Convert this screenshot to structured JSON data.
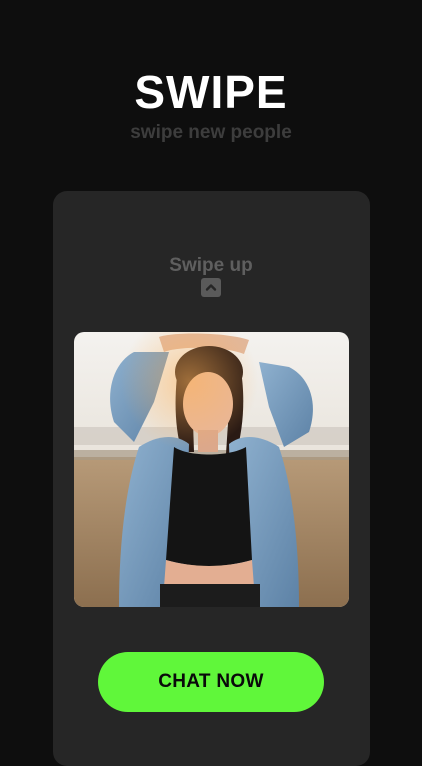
{
  "header": {
    "title": "SWIPE",
    "subtitle": "swipe new people"
  },
  "card": {
    "swipe_label": "Swipe up",
    "swipe_icon": "chevron-up-icon",
    "photo": "profile-photo"
  },
  "cta": {
    "label": "CHAT NOW"
  },
  "colors": {
    "background": "#0e0e0e",
    "card": "#262626",
    "accent": "#60f73a",
    "subtitle": "#3d3d3d",
    "swipe_label": "#5f5f5f"
  }
}
